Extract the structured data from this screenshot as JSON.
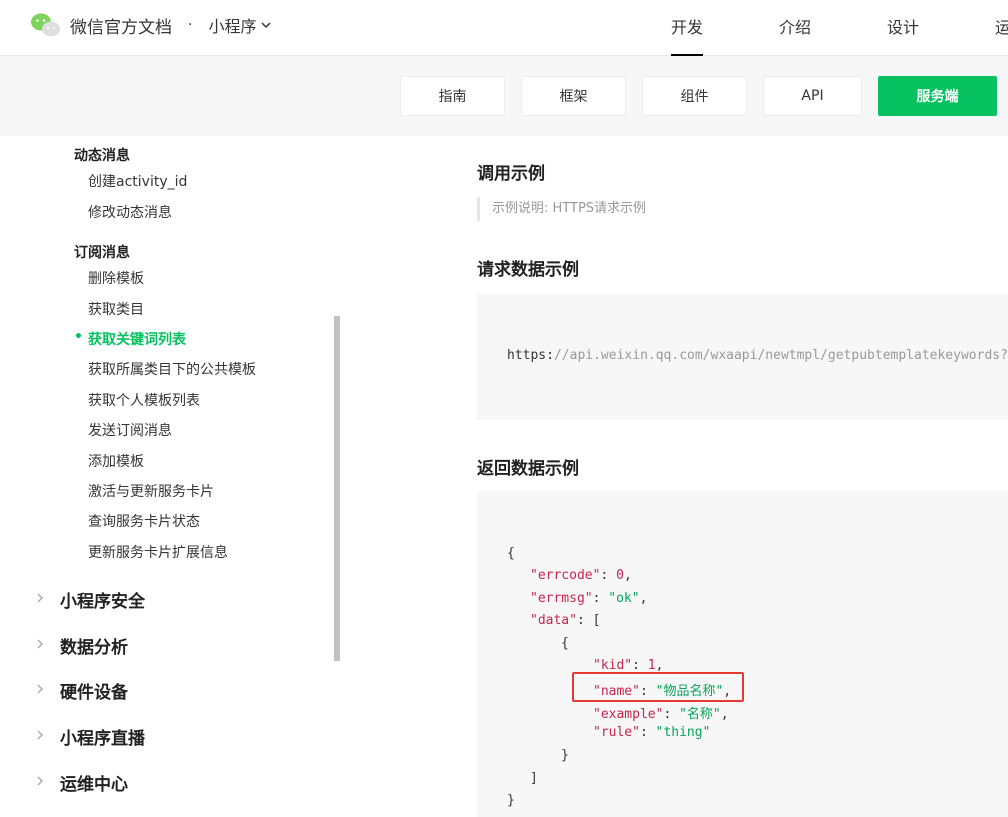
{
  "header": {
    "brand_title": "微信官方文档",
    "brand_dot": "·",
    "brand_sub": "小程序",
    "nav": [
      "开发",
      "介绍",
      "设计",
      "运"
    ]
  },
  "subnav": {
    "tabs": [
      "指南",
      "框架",
      "组件",
      "API",
      "服务端"
    ],
    "active_tab": "服务端"
  },
  "sidebar": {
    "sections": [
      {
        "title": "动态消息",
        "items": [
          "创建activity_id",
          "修改动态消息"
        ]
      },
      {
        "title": "订阅消息",
        "items": [
          "删除模板",
          "获取类目",
          "获取关键词列表",
          "获取所属类目下的公共模板",
          "获取个人模板列表",
          "发送订阅消息",
          "添加模板",
          "激活与更新服务卡片",
          "查询服务卡片状态",
          "更新服务卡片扩展信息"
        ]
      }
    ],
    "active_item": "获取关键词列表",
    "active_bullet": "•",
    "groups": [
      "小程序安全",
      "数据分析",
      "硬件设备",
      "小程序直播",
      "运维中心"
    ]
  },
  "content": {
    "call_example_title": "调用示例",
    "example_note": "示例说明: HTTPS请求示例",
    "request_title": "请求数据示例",
    "request_url_scheme": "https:",
    "request_url_slashes": "//",
    "request_url_rest": "api.weixin.qq.com/wxaapi/newtmpl/getpubtemplatekeywords?a",
    "response_title": "返回数据示例",
    "json": {
      "open_brace": "{",
      "errcode_key": "\"errcode\"",
      "errcode_val": "0",
      "errmsg_key": "\"errmsg\"",
      "errmsg_val": "\"ok\"",
      "data_key": "\"data\"",
      "open_bracket": "[",
      "inner_open": "{",
      "kid_key": "\"kid\"",
      "kid_val": "1",
      "name_key": "\"name\"",
      "name_val": "\"物品名称\"",
      "example_key": "\"example\"",
      "example_val": "\"名称\"",
      "rule_key": "\"rule\"",
      "rule_val": "\"thing\"",
      "inner_close": "}",
      "close_bracket": "]",
      "close_brace": "}",
      "colon": ":",
      "comma": ","
    }
  },
  "colors": {
    "accent": "#07c160",
    "highlight_border": "#e53935",
    "json_key": "#c7254e",
    "json_string": "#07a35a"
  }
}
